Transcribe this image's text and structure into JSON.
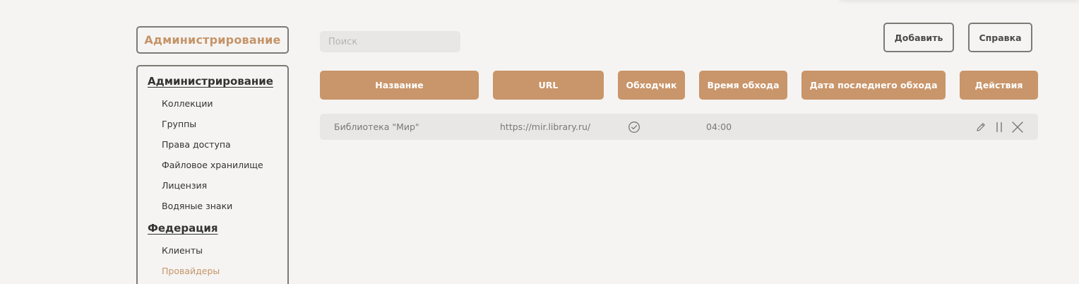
{
  "header": {
    "section_title": "Администрирование",
    "search_placeholder": "Поиск",
    "add_label": "Добавить",
    "help_label": "Справка"
  },
  "sidebar": {
    "sections": [
      {
        "title": "Администрирование",
        "items": [
          "Коллекции",
          "Группы",
          "Права доступа",
          "Файловое хранилище",
          "Лицензия",
          "Водяные знаки"
        ]
      },
      {
        "title": "Федерация",
        "items": [
          "Клиенты",
          "Провайдеры"
        ]
      }
    ],
    "active_item": "Провайдеры"
  },
  "table": {
    "columns": [
      "Название",
      "URL",
      "Обходчик",
      "Время обхода",
      "Дата последнего обхода",
      "Действия"
    ],
    "rows": [
      {
        "name": "Библиотека \"Мир\"",
        "url": "https://mir.library.ru/",
        "crawler_enabled": true,
        "crawl_time": "04:00",
        "last_crawl_date": ""
      }
    ]
  },
  "icons": {
    "crawler": "check-circle-icon",
    "edit": "pencil-icon",
    "pause": "pause-icon",
    "delete": "close-icon"
  },
  "colors": {
    "accent": "#c9956a",
    "accent_text": "#c59468",
    "border": "#7d7a76",
    "background": "#f5f4f2",
    "row_bg": "#e8e7e5"
  }
}
